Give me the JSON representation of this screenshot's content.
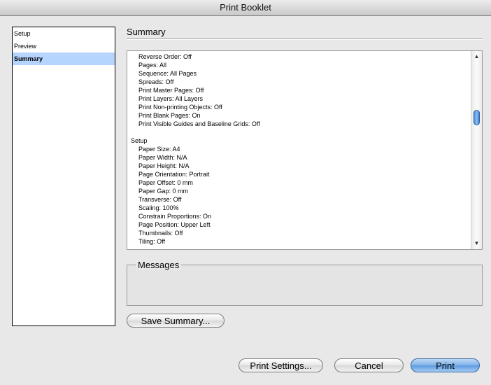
{
  "window": {
    "title": "Print Booklet"
  },
  "nav": {
    "items": [
      {
        "label": "Setup",
        "selected": false
      },
      {
        "label": "Preview",
        "selected": false
      },
      {
        "label": "Summary",
        "selected": true
      }
    ]
  },
  "summary": {
    "title": "Summary",
    "lines": [
      {
        "text": "Reverse Order: Off",
        "indent": true
      },
      {
        "text": "Pages: All",
        "indent": true
      },
      {
        "text": "Sequence: All Pages",
        "indent": true
      },
      {
        "text": "Spreads: Off",
        "indent": true
      },
      {
        "text": "Print Master Pages: Off",
        "indent": true
      },
      {
        "text": "Print Layers: All Layers",
        "indent": true
      },
      {
        "text": "Print Non-printing Objects: Off",
        "indent": true
      },
      {
        "text": "Print Blank Pages: On",
        "indent": true
      },
      {
        "text": "Print Visible Guides and Baseline Grids: Off",
        "indent": true
      },
      {
        "text": "",
        "indent": false
      },
      {
        "text": "Setup",
        "indent": false
      },
      {
        "text": "Paper Size: A4",
        "indent": true
      },
      {
        "text": "Paper Width: N/A",
        "indent": true
      },
      {
        "text": "Paper Height: N/A",
        "indent": true
      },
      {
        "text": "Page Orientation: Portrait",
        "indent": true
      },
      {
        "text": "Paper Offset: 0 mm",
        "indent": true
      },
      {
        "text": "Paper Gap: 0 mm",
        "indent": true
      },
      {
        "text": "Transverse: Off",
        "indent": true
      },
      {
        "text": "Scaling: 100%",
        "indent": true
      },
      {
        "text": "Constrain Proportions: On",
        "indent": true
      },
      {
        "text": "Page Position: Upper Left",
        "indent": true
      },
      {
        "text": "Thumbnails: Off",
        "indent": true
      },
      {
        "text": "Tiling: Off",
        "indent": true
      }
    ],
    "scroll_position": 0.3
  },
  "messages": {
    "title": "Messages"
  },
  "buttons": {
    "save_summary": "Save Summary...",
    "print_settings": "Print Settings...",
    "cancel": "Cancel",
    "print": "Print"
  },
  "icons": {
    "scroll_up": "up-arrow",
    "scroll_down": "down-arrow"
  },
  "colors": {
    "selection": "#b5d5ff",
    "default_button": "#5d9ae0"
  }
}
